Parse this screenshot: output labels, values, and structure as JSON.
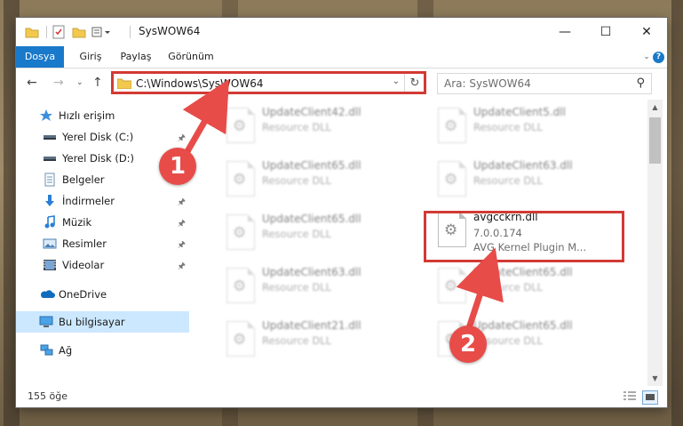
{
  "window": {
    "title": "SysWOW64"
  },
  "ribbon": {
    "tabs": [
      "Dosya",
      "Giriş",
      "Paylaş",
      "Görünüm"
    ]
  },
  "address": {
    "path": "C:\\Windows\\SysWOW64"
  },
  "search": {
    "placeholder": "Ara: SysWOW64"
  },
  "nav": {
    "items": [
      {
        "label": "Hızlı erişim",
        "icon": "star-icon",
        "pinned": false
      },
      {
        "label": "Yerel Disk (C:)",
        "icon": "drive-icon",
        "pinned": true
      },
      {
        "label": "Yerel Disk (D:)",
        "icon": "drive-icon",
        "pinned": false
      },
      {
        "label": "Belgeler",
        "icon": "documents-icon",
        "pinned": true
      },
      {
        "label": "İndirmeler",
        "icon": "download-icon",
        "pinned": true
      },
      {
        "label": "Müzik",
        "icon": "music-icon",
        "pinned": true
      },
      {
        "label": "Resimler",
        "icon": "pictures-icon",
        "pinned": true
      },
      {
        "label": "Videolar",
        "icon": "videos-icon",
        "pinned": true
      },
      {
        "label": "OneDrive",
        "icon": "cloud-icon",
        "pinned": false
      },
      {
        "label": "Bu bilgisayar",
        "icon": "computer-icon",
        "pinned": false,
        "selected": true
      },
      {
        "label": "Ağ",
        "icon": "network-icon",
        "pinned": false
      }
    ]
  },
  "files": [
    {
      "name": "UpdateClient42.dll",
      "line2": "Resource DLL",
      "line3": ""
    },
    {
      "name": "UpdateClient5.dll",
      "line2": "Resource DLL",
      "line3": ""
    },
    {
      "name": "UpdateClient65.dll",
      "line2": "Resource DLL",
      "line3": ""
    },
    {
      "name": "UpdateClient63.dll",
      "line2": "Resource DLL",
      "line3": ""
    },
    {
      "name": "UpdateClient65.dll",
      "line2": "Resource DLL",
      "line3": ""
    },
    {
      "name": "avgcckrn.dll",
      "line2": "7.0.0.174",
      "line3": "AVG Kernel Plugin M...",
      "highlighted": true
    },
    {
      "name": "UpdateClient63.dll",
      "line2": "Resource DLL",
      "line3": ""
    },
    {
      "name": "UpdateClient65.dll",
      "line2": "Resource DLL",
      "line3": ""
    },
    {
      "name": "UpdateClient21.dll",
      "line2": "Resource DLL",
      "line3": ""
    },
    {
      "name": "UpdateClient65.dll",
      "line2": "Resource DLL",
      "line3": ""
    }
  ],
  "status": {
    "count": "155 öğe"
  },
  "annotations": {
    "step1": "1",
    "step2": "2",
    "color": "#d23a35"
  }
}
